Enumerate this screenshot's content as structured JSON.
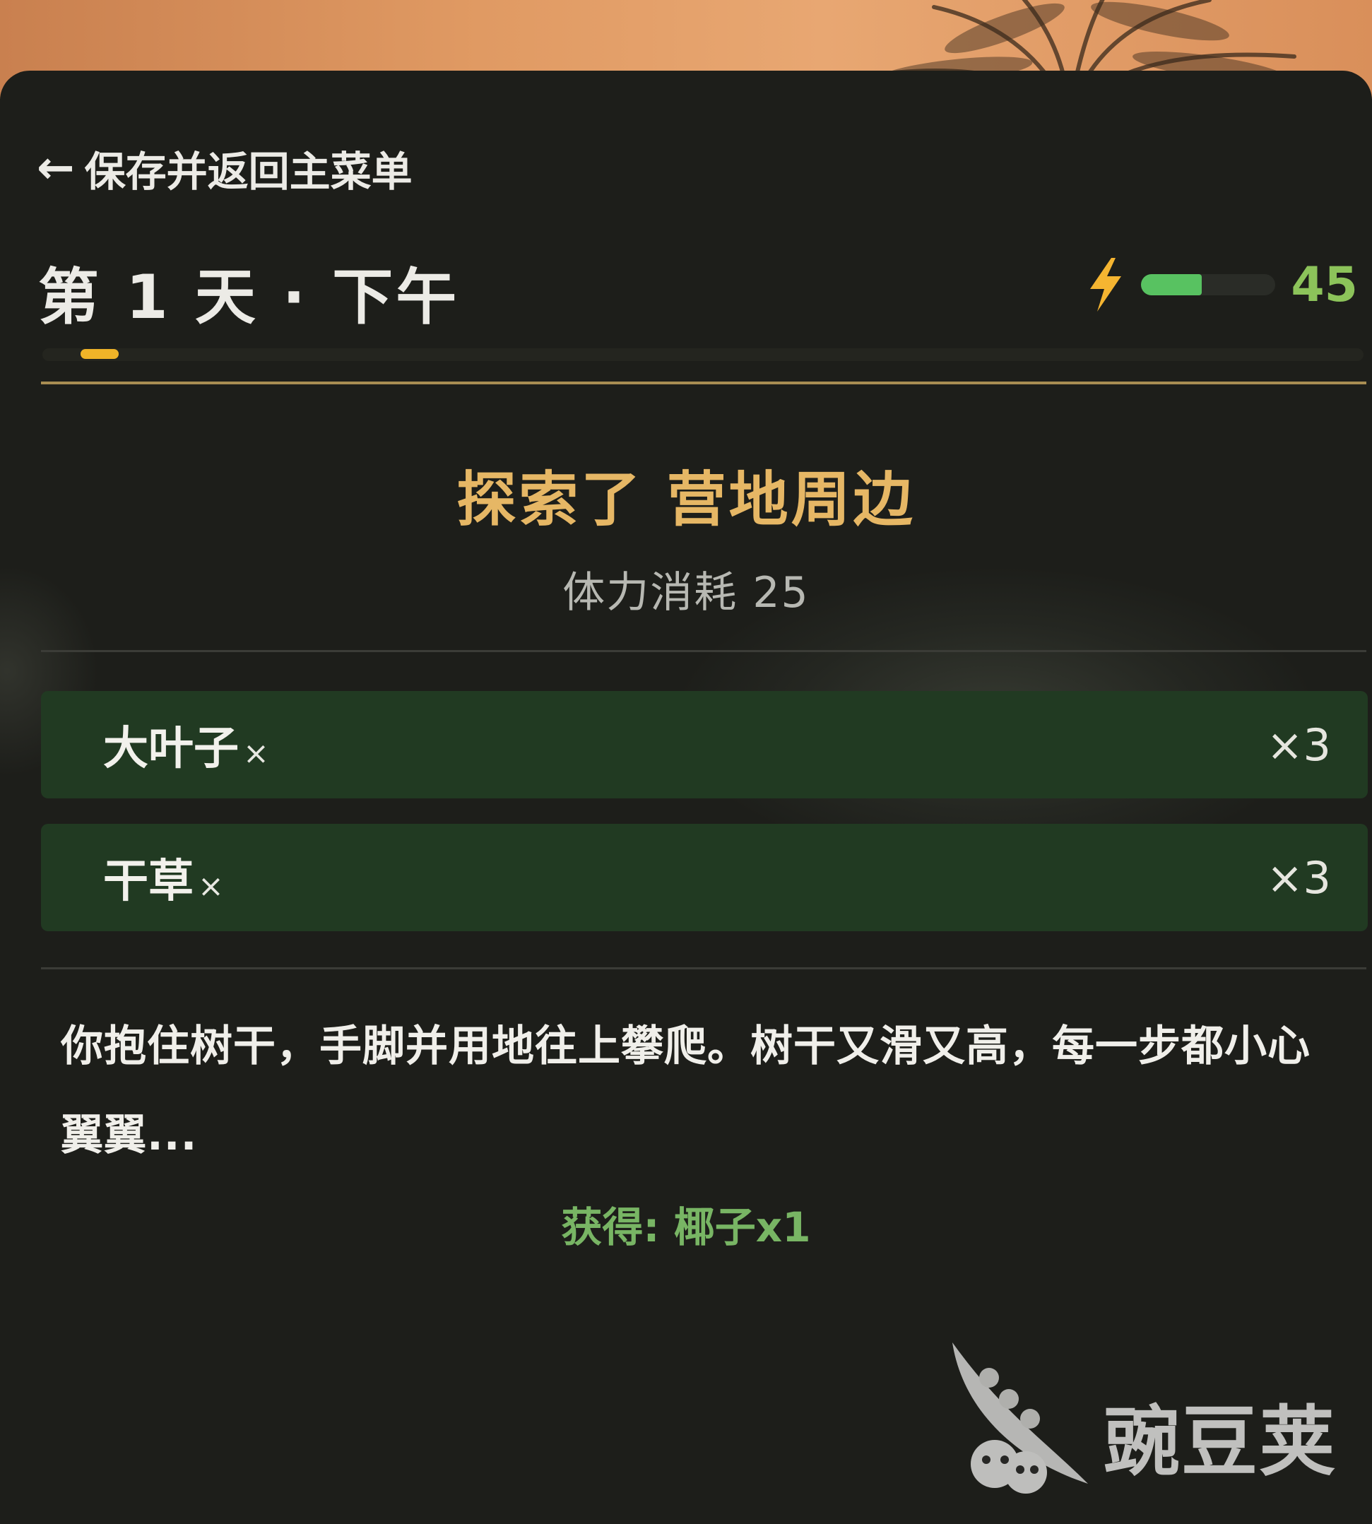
{
  "header": {
    "back_arrow_glyph": "←",
    "back_label": "保存并返回主菜单",
    "day_title": "第 1 天 · 下午",
    "stamina": {
      "icon": "lightning-icon",
      "value": "45",
      "fill_fraction": 0.45,
      "bar_color": "#58c261",
      "value_color": "#8cc35a"
    },
    "day_progress_color": "#f0b428"
  },
  "event": {
    "title": "探索了 营地周边",
    "stamina_cost": "体力消耗 25",
    "title_color": "#e6b765"
  },
  "items": [
    {
      "name": "大叶子",
      "x_mark": "×",
      "quantity": "×3"
    },
    {
      "name": "干草",
      "x_mark": "×",
      "quantity": "×3"
    }
  ],
  "narrative": "你抱住树干，手脚并用地往上攀爬。树干又滑又高，每一步都小心翼翼...",
  "reward": {
    "text": "获得: 椰子x1",
    "color": "#78b564"
  },
  "watermark": {
    "text": "豌豆荚",
    "icon": "pea-pod-logo"
  }
}
